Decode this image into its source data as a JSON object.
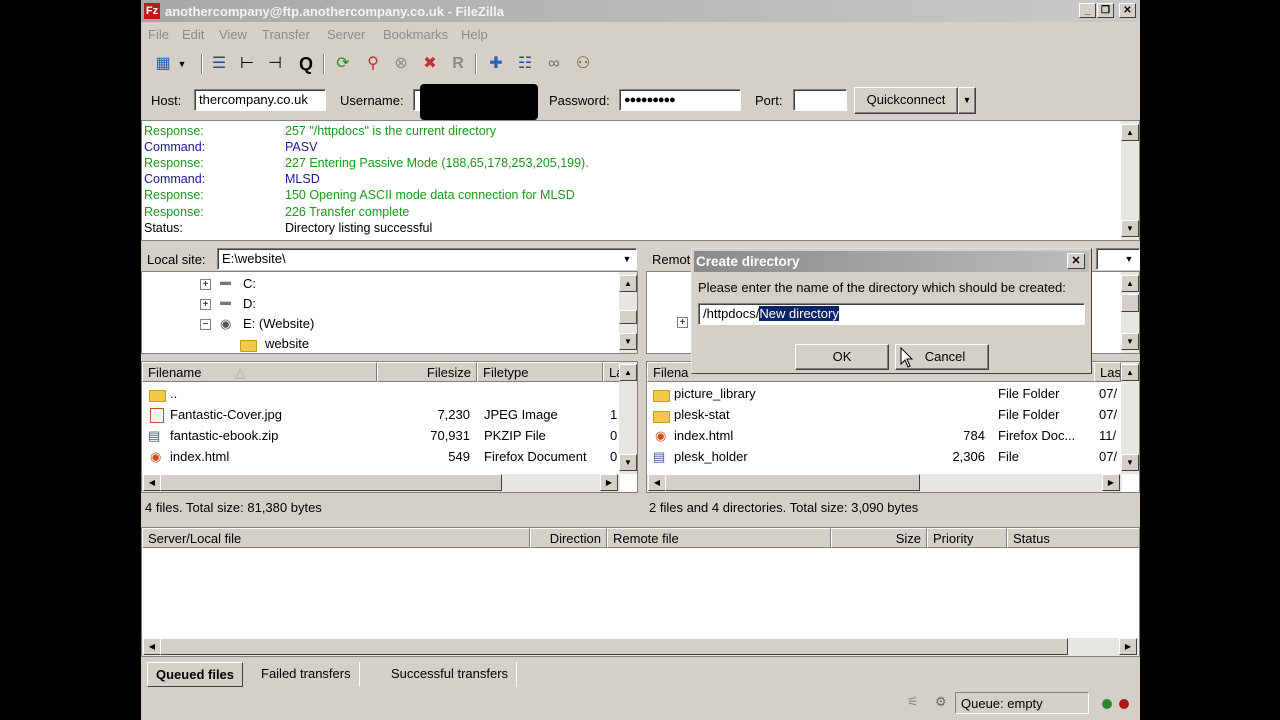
{
  "window": {
    "title": "anothercompany@ftp.anothercompany.co.uk - FileZilla",
    "app_icon": "Fz",
    "controls": {
      "minimize": "_",
      "restore": "❐",
      "close": "✕"
    }
  },
  "menu": [
    "File",
    "Edit",
    "View",
    "Transfer",
    "Server",
    "Bookmarks",
    "Help"
  ],
  "toolbar_icons": [
    "site-manager-icon",
    "toggle-log-icon",
    "toggle-local-tree-icon",
    "toggle-remote-tree-icon",
    "toggle-queue-icon",
    "refresh-icon",
    "process-queue-icon",
    "cancel-icon",
    "disconnect-icon",
    "reconnect-icon",
    "compare-icon",
    "filter-icon",
    "sync-browse-icon",
    "search-icon"
  ],
  "quickconnect": {
    "host_label": "Host:",
    "host_value": "thercompany.co.uk",
    "username_label": "Username:",
    "password_label": "Password:",
    "password_value": "●●●●●●●●●",
    "port_label": "Port:",
    "port_value": "",
    "button": "Quickconnect",
    "dropdown": "▼"
  },
  "log": [
    {
      "type": "Response:",
      "msg": "257 \"/httpdocs\" is the current directory",
      "color": "#1a9a1a"
    },
    {
      "type": "Command:",
      "msg": "PASV",
      "color": "#1a1a9a"
    },
    {
      "type": "Response:",
      "msg": "227 Entering Passive Mode (188,65,178,253,205,199).",
      "color": "#1a9a1a"
    },
    {
      "type": "Command:",
      "msg": "MLSD",
      "color": "#1a1a9a"
    },
    {
      "type": "Response:",
      "msg": "150 Opening ASCII mode data connection for MLSD",
      "color": "#1a9a1a"
    },
    {
      "type": "Response:",
      "msg": "226 Transfer complete",
      "color": "#1a9a1a"
    },
    {
      "type": "Status:",
      "msg": "Directory listing successful",
      "color": "#000000"
    }
  ],
  "local": {
    "site_label": "Local site:",
    "site_path": "E:\\website\\",
    "tree": [
      {
        "label": "C:",
        "expander": "+"
      },
      {
        "label": "D:",
        "expander": "+"
      },
      {
        "label": "E: (Website)",
        "expander": "−"
      },
      {
        "label": "website",
        "expander": ""
      }
    ],
    "columns": {
      "filename": "Filename",
      "sort": "△",
      "filesize": "Filesize",
      "filetype": "Filetype",
      "last": "La"
    },
    "files": [
      {
        "name": "..",
        "size": "",
        "type": "",
        "date": ""
      },
      {
        "name": "Fantastic-Cover.jpg",
        "size": "7,230",
        "type": "JPEG Image",
        "date": "1"
      },
      {
        "name": "fantastic-ebook.zip",
        "size": "70,931",
        "type": "PKZIP File",
        "date": "0"
      },
      {
        "name": "index.html",
        "size": "549",
        "type": "Firefox Document",
        "date": "0"
      }
    ],
    "status": "4 files. Total size: 81,380 bytes"
  },
  "remote": {
    "site_label": "Remot",
    "columns": {
      "filename": "Filena",
      "last": "Las"
    },
    "files": [
      {
        "name": "picture_library",
        "size": "",
        "type": "File Folder",
        "date": "07/"
      },
      {
        "name": "plesk-stat",
        "size": "",
        "type": "File Folder",
        "date": "07/"
      },
      {
        "name": "index.html",
        "size": "784",
        "type": "Firefox Doc...",
        "date": "11/"
      },
      {
        "name": "plesk_holder",
        "size": "2,306",
        "type": "File",
        "date": "07/"
      }
    ],
    "status": "2 files and 4 directories. Total size: 3,090 bytes"
  },
  "dialog": {
    "title": "Create directory",
    "close": "✕",
    "prompt": "Please enter the name of the directory which should be created:",
    "value_prefix": "/httpdocs/",
    "value_selected": "New directory",
    "ok": "OK",
    "cancel": "Cancel"
  },
  "queue": {
    "columns": {
      "server": "Server/Local file",
      "direction": "Direction",
      "remote": "Remote file",
      "size": "Size",
      "priority": "Priority",
      "status": "Status"
    },
    "tabs": [
      "Queued files",
      "Failed transfers",
      "Successful transfers"
    ],
    "status": "Queue: empty"
  }
}
